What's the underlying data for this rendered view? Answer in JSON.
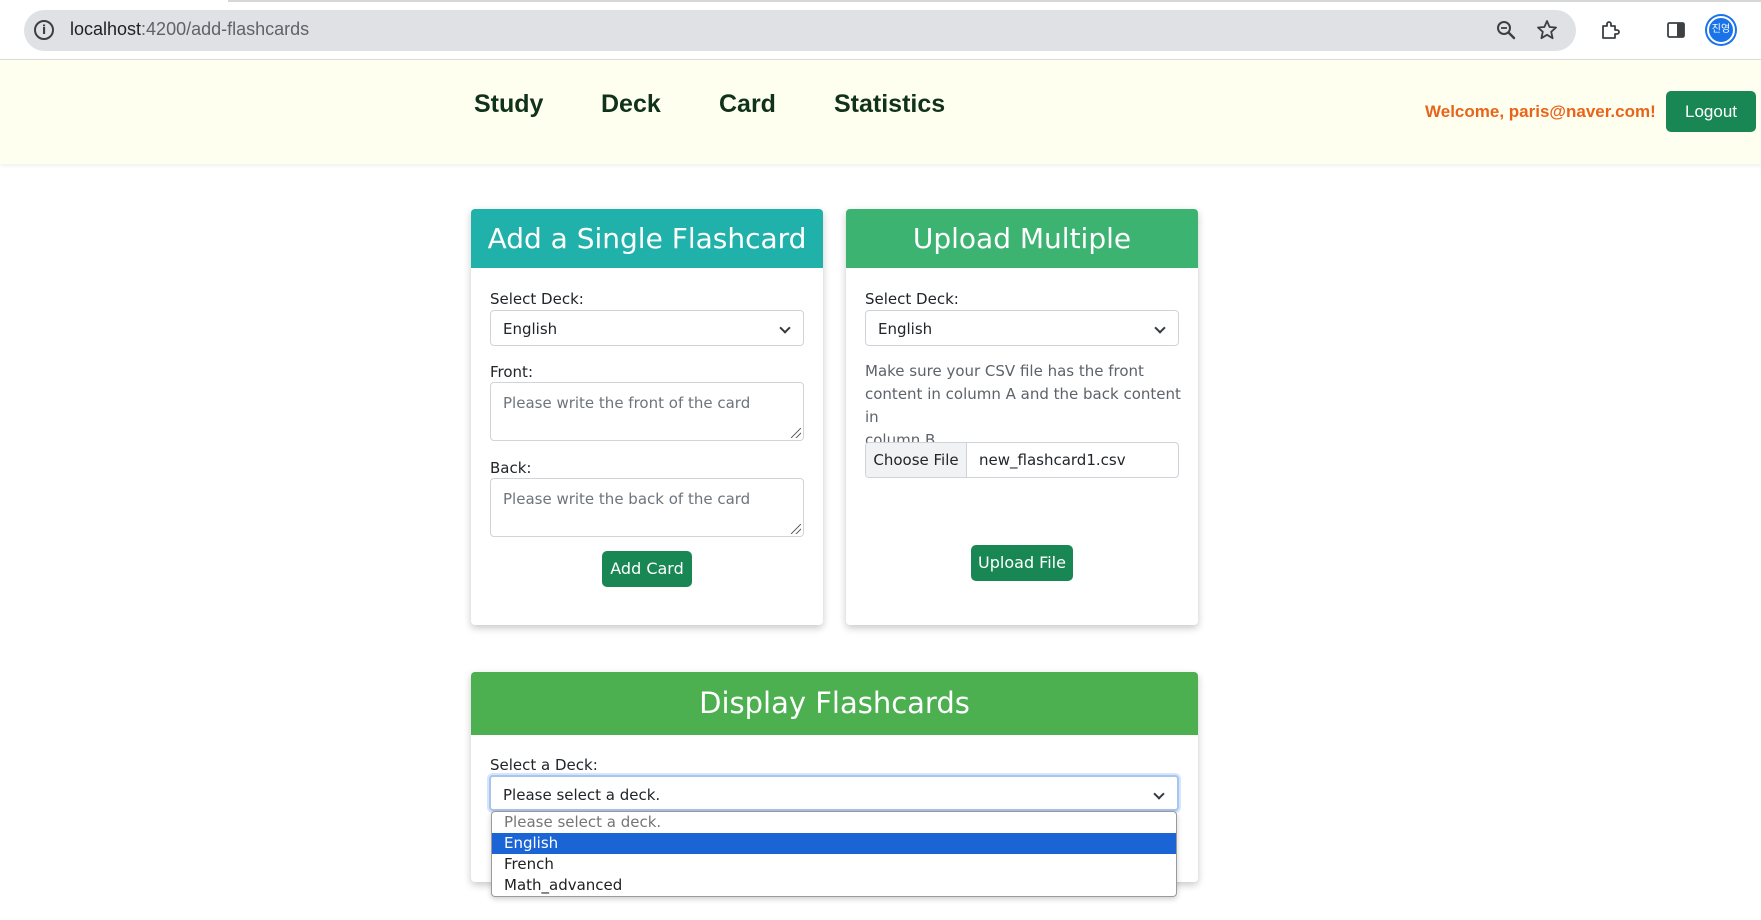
{
  "browser": {
    "url_host": "localhost",
    "url_path": ":4200/add-flashcards",
    "avatar_text": "진영"
  },
  "navbar": {
    "links": [
      "Study",
      "Deck",
      "Card",
      "Statistics"
    ],
    "welcome": "Welcome, paris@naver.com!",
    "logout_label": "Logout"
  },
  "single_card": {
    "title": "Add a Single Flashcard",
    "select_deck_label": "Select Deck:",
    "selected_deck": "English",
    "front_label": "Front:",
    "front_placeholder": "Please write the front of the card",
    "back_label": "Back:",
    "back_placeholder": "Please write the back of the card",
    "add_button": "Add Card",
    "header_color": "#20b2aa"
  },
  "upload_card": {
    "title": "Upload Multiple Flashcards",
    "select_deck_label": "Select Deck:",
    "selected_deck": "English",
    "help_line1": "Make sure your CSV file has the front",
    "help_line2": "content in column A and the back content in",
    "help_line3": "column B.",
    "choose_file_label": "Choose File",
    "file_name": "new_flashcard1.csv",
    "upload_button": "Upload File",
    "header_color": "#3cb371"
  },
  "display_card": {
    "title": "Display Flashcards",
    "select_label": "Select a Deck:",
    "selected_value": "Please select a deck.",
    "options": [
      "Please select a deck.",
      "English",
      "French",
      "Math_advanced"
    ],
    "highlighted_option": "English",
    "header_color": "#4caf50"
  }
}
